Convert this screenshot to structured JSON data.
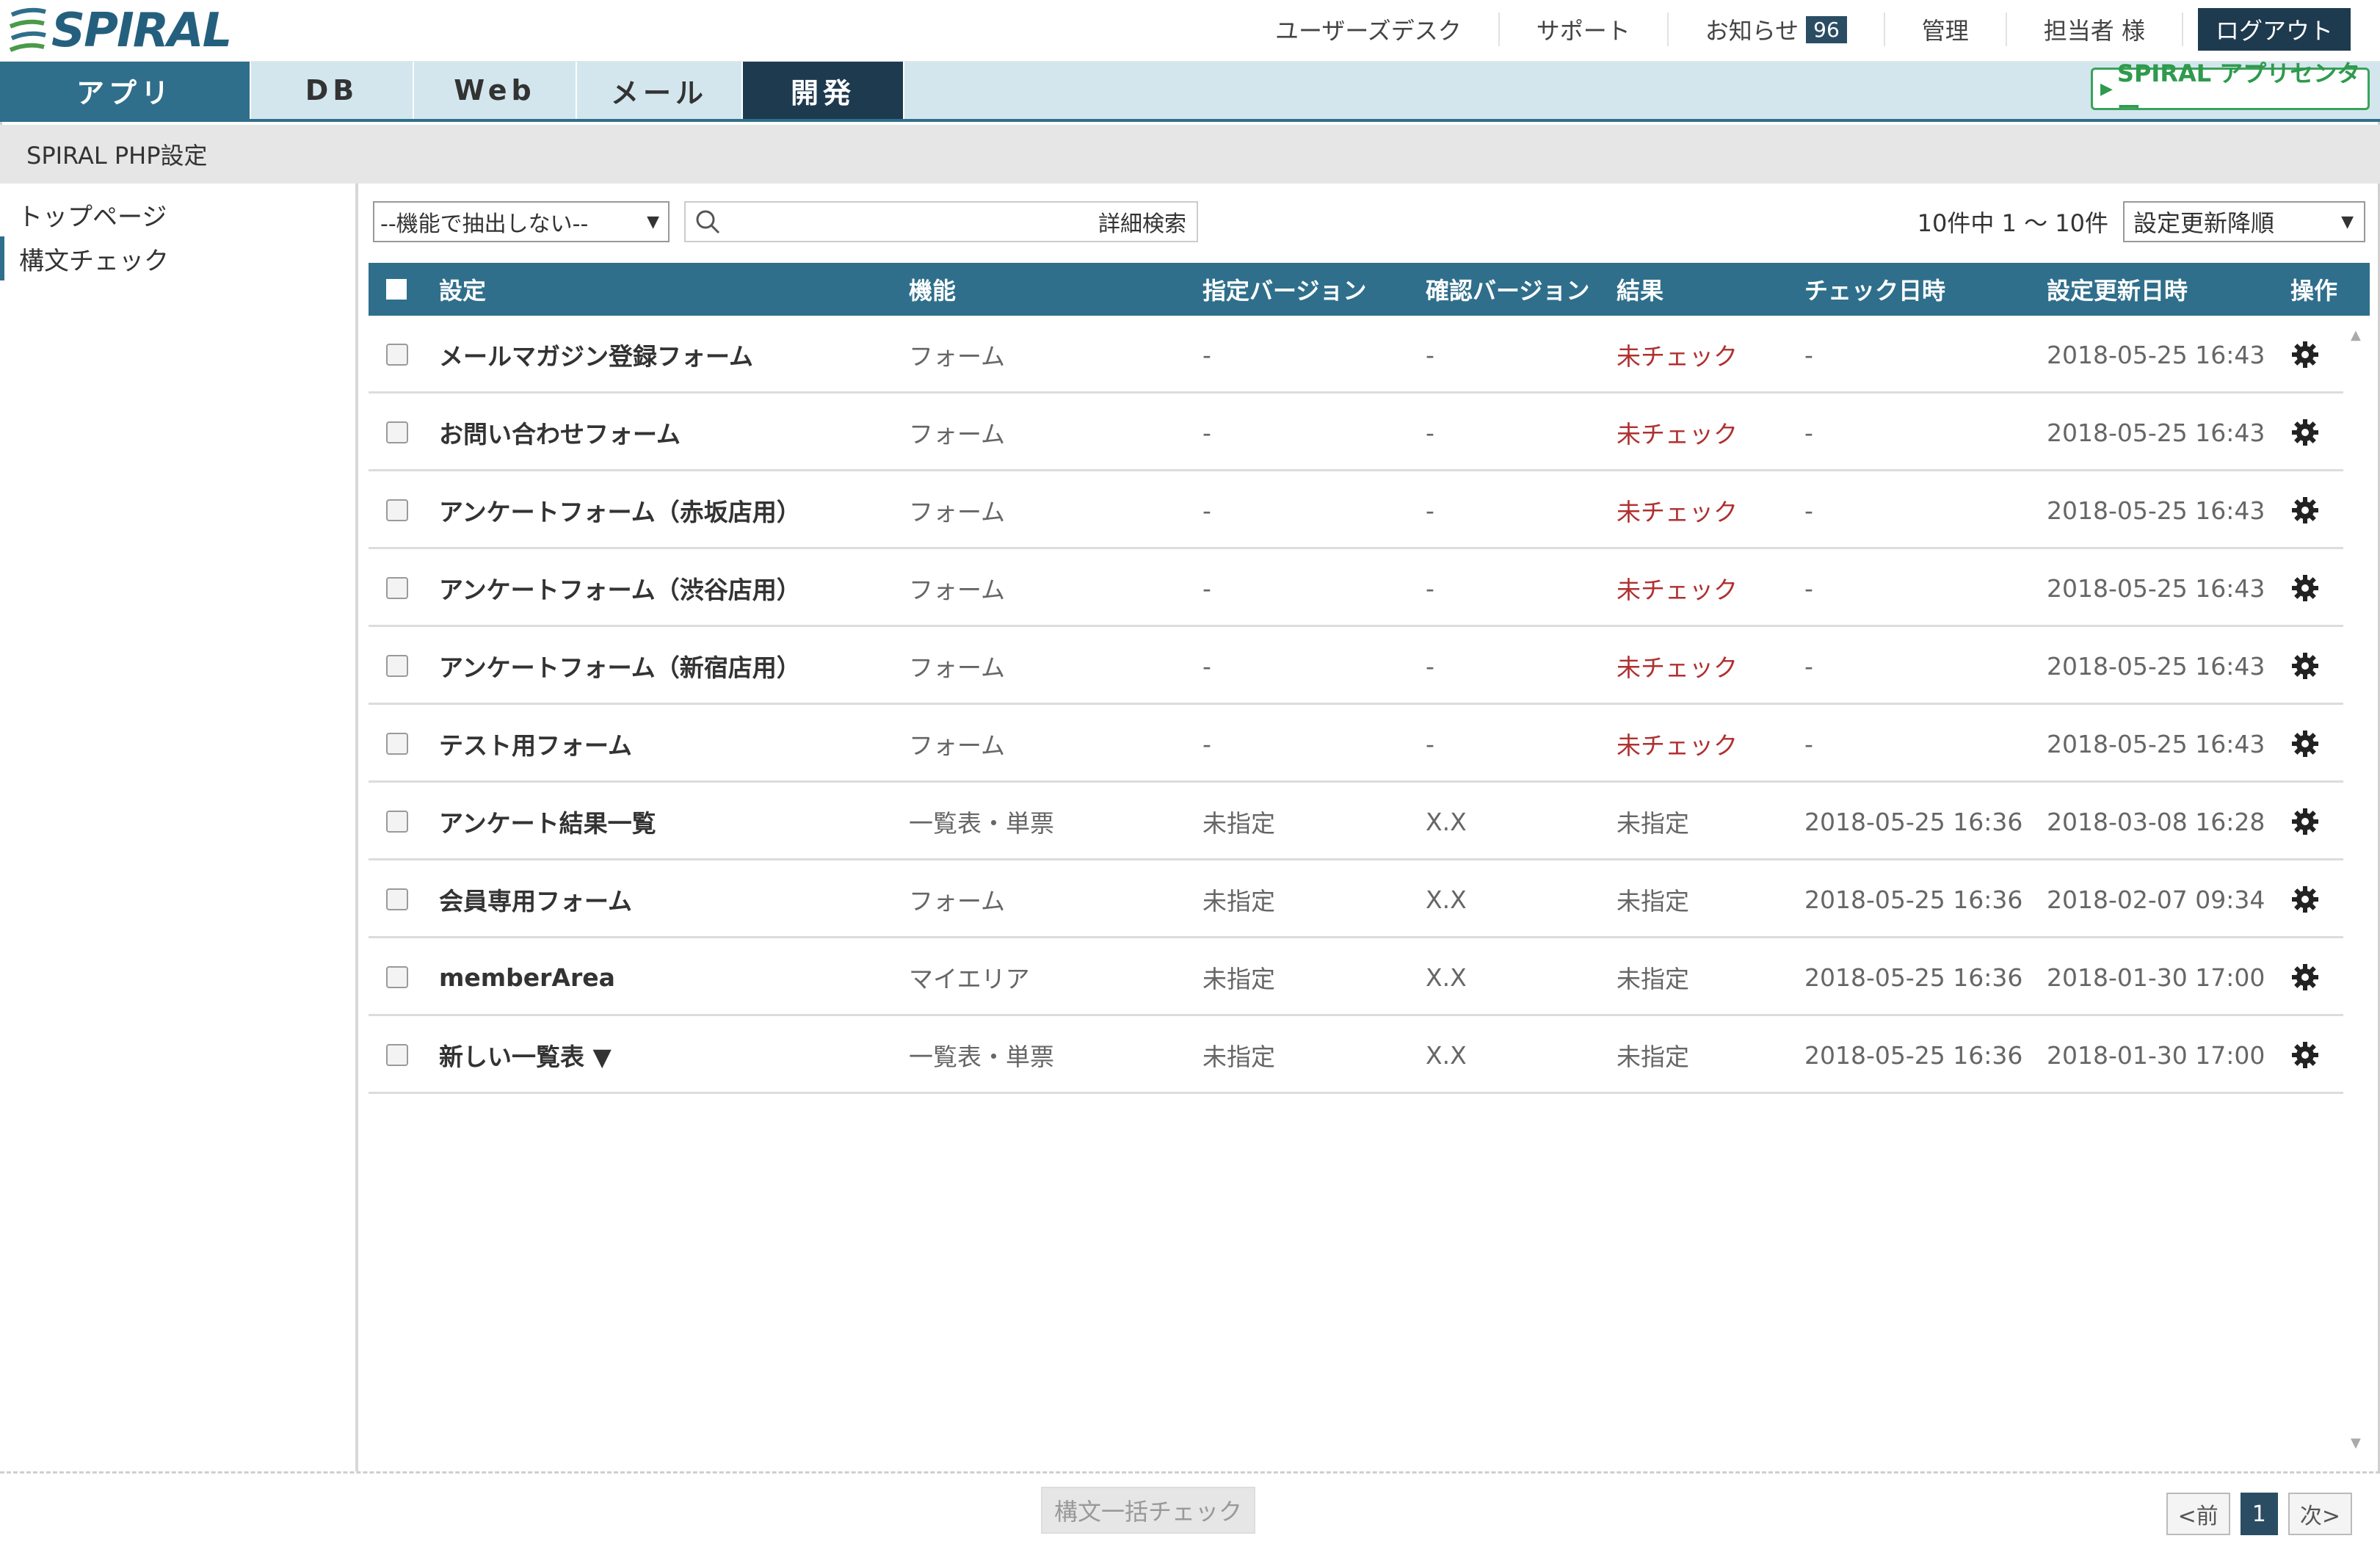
{
  "header": {
    "logo_text": "SPIRAL",
    "links": {
      "user_desk": "ユーザーズデスク",
      "support": "サポート",
      "notifications": "お知らせ",
      "notification_count": "96",
      "admin": "管理",
      "user_name": "担当者 様",
      "logout": "ログアウト"
    }
  },
  "tabs": {
    "app": "アプリ",
    "db": "DB",
    "web": "Web",
    "mail": "メール",
    "dev": "開発",
    "app_center": "SPIRAL アプリセンター"
  },
  "page": {
    "section_title": "SPIRAL PHP設定"
  },
  "sidebar": {
    "items": [
      "トップページ",
      "構文チェック"
    ],
    "active_index": 1
  },
  "toolbar": {
    "filter_value": "--機能で抽出しない--",
    "search_placeholder": "",
    "detail_search": "詳細検索",
    "count_text": "10件中 1 ～ 10件",
    "sort_value": "設定更新降順"
  },
  "table": {
    "headers": {
      "name": "設定",
      "function": "機能",
      "specified_version": "指定バージョン",
      "confirmed_version": "確認バージョン",
      "result": "結果",
      "checked_at": "チェック日時",
      "updated_at": "設定更新日時",
      "operation": "操作"
    },
    "rows": [
      {
        "name": "メールマガジン登録フォーム",
        "function": "フォーム",
        "spec": "-",
        "conf": "-",
        "result": "未チェック",
        "checked": "-",
        "updated": "2018-05-25 16:43"
      },
      {
        "name": "お問い合わせフォーム",
        "function": "フォーム",
        "spec": "-",
        "conf": "-",
        "result": "未チェック",
        "checked": "-",
        "updated": "2018-05-25 16:43"
      },
      {
        "name": "アンケートフォーム（赤坂店用）",
        "function": "フォーム",
        "spec": "-",
        "conf": "-",
        "result": "未チェック",
        "checked": "-",
        "updated": "2018-05-25 16:43"
      },
      {
        "name": "アンケートフォーム（渋谷店用）",
        "function": "フォーム",
        "spec": "-",
        "conf": "-",
        "result": "未チェック",
        "checked": "-",
        "updated": "2018-05-25 16:43"
      },
      {
        "name": "アンケートフォーム（新宿店用）",
        "function": "フォーム",
        "spec": "-",
        "conf": "-",
        "result": "未チェック",
        "checked": "-",
        "updated": "2018-05-25 16:43"
      },
      {
        "name": "テスト用フォーム",
        "function": "フォーム",
        "spec": "-",
        "conf": "-",
        "result": "未チェック",
        "checked": "-",
        "updated": "2018-05-25 16:43"
      },
      {
        "name": "アンケート結果一覧",
        "function": "一覧表・単票",
        "spec": "未指定",
        "conf": "X.X",
        "result": "未指定",
        "checked": "2018-05-25 16:36",
        "updated": "2018-03-08 16:28"
      },
      {
        "name": "会員専用フォーム",
        "function": "フォーム",
        "spec": "未指定",
        "conf": "X.X",
        "result": "未指定",
        "checked": "2018-05-25 16:36",
        "updated": "2018-02-07 09:34"
      },
      {
        "name": "memberArea",
        "function": "マイエリア",
        "spec": "未指定",
        "conf": "X.X",
        "result": "未指定",
        "checked": "2018-05-25 16:36",
        "updated": "2018-01-30 17:00"
      },
      {
        "name": "新しい一覧表 ▼",
        "function": "一覧表・単票",
        "spec": "未指定",
        "conf": "X.X",
        "result": "未指定",
        "checked": "2018-05-25 16:36",
        "updated": "2018-01-30 17:00"
      }
    ]
  },
  "footer": {
    "bulk_check": "構文一括チェック",
    "pager": {
      "prev": "<前",
      "current": "1",
      "next": "次>"
    }
  },
  "colors": {
    "brand_blue": "#2f6f8b",
    "dark_navy": "#1e3a4f",
    "unchecked_red": "#b03030",
    "app_center_green": "#3aa35a"
  },
  "icons": [
    "search-icon",
    "gear-icon",
    "chevron-down-icon",
    "spiral-logo-icon"
  ]
}
